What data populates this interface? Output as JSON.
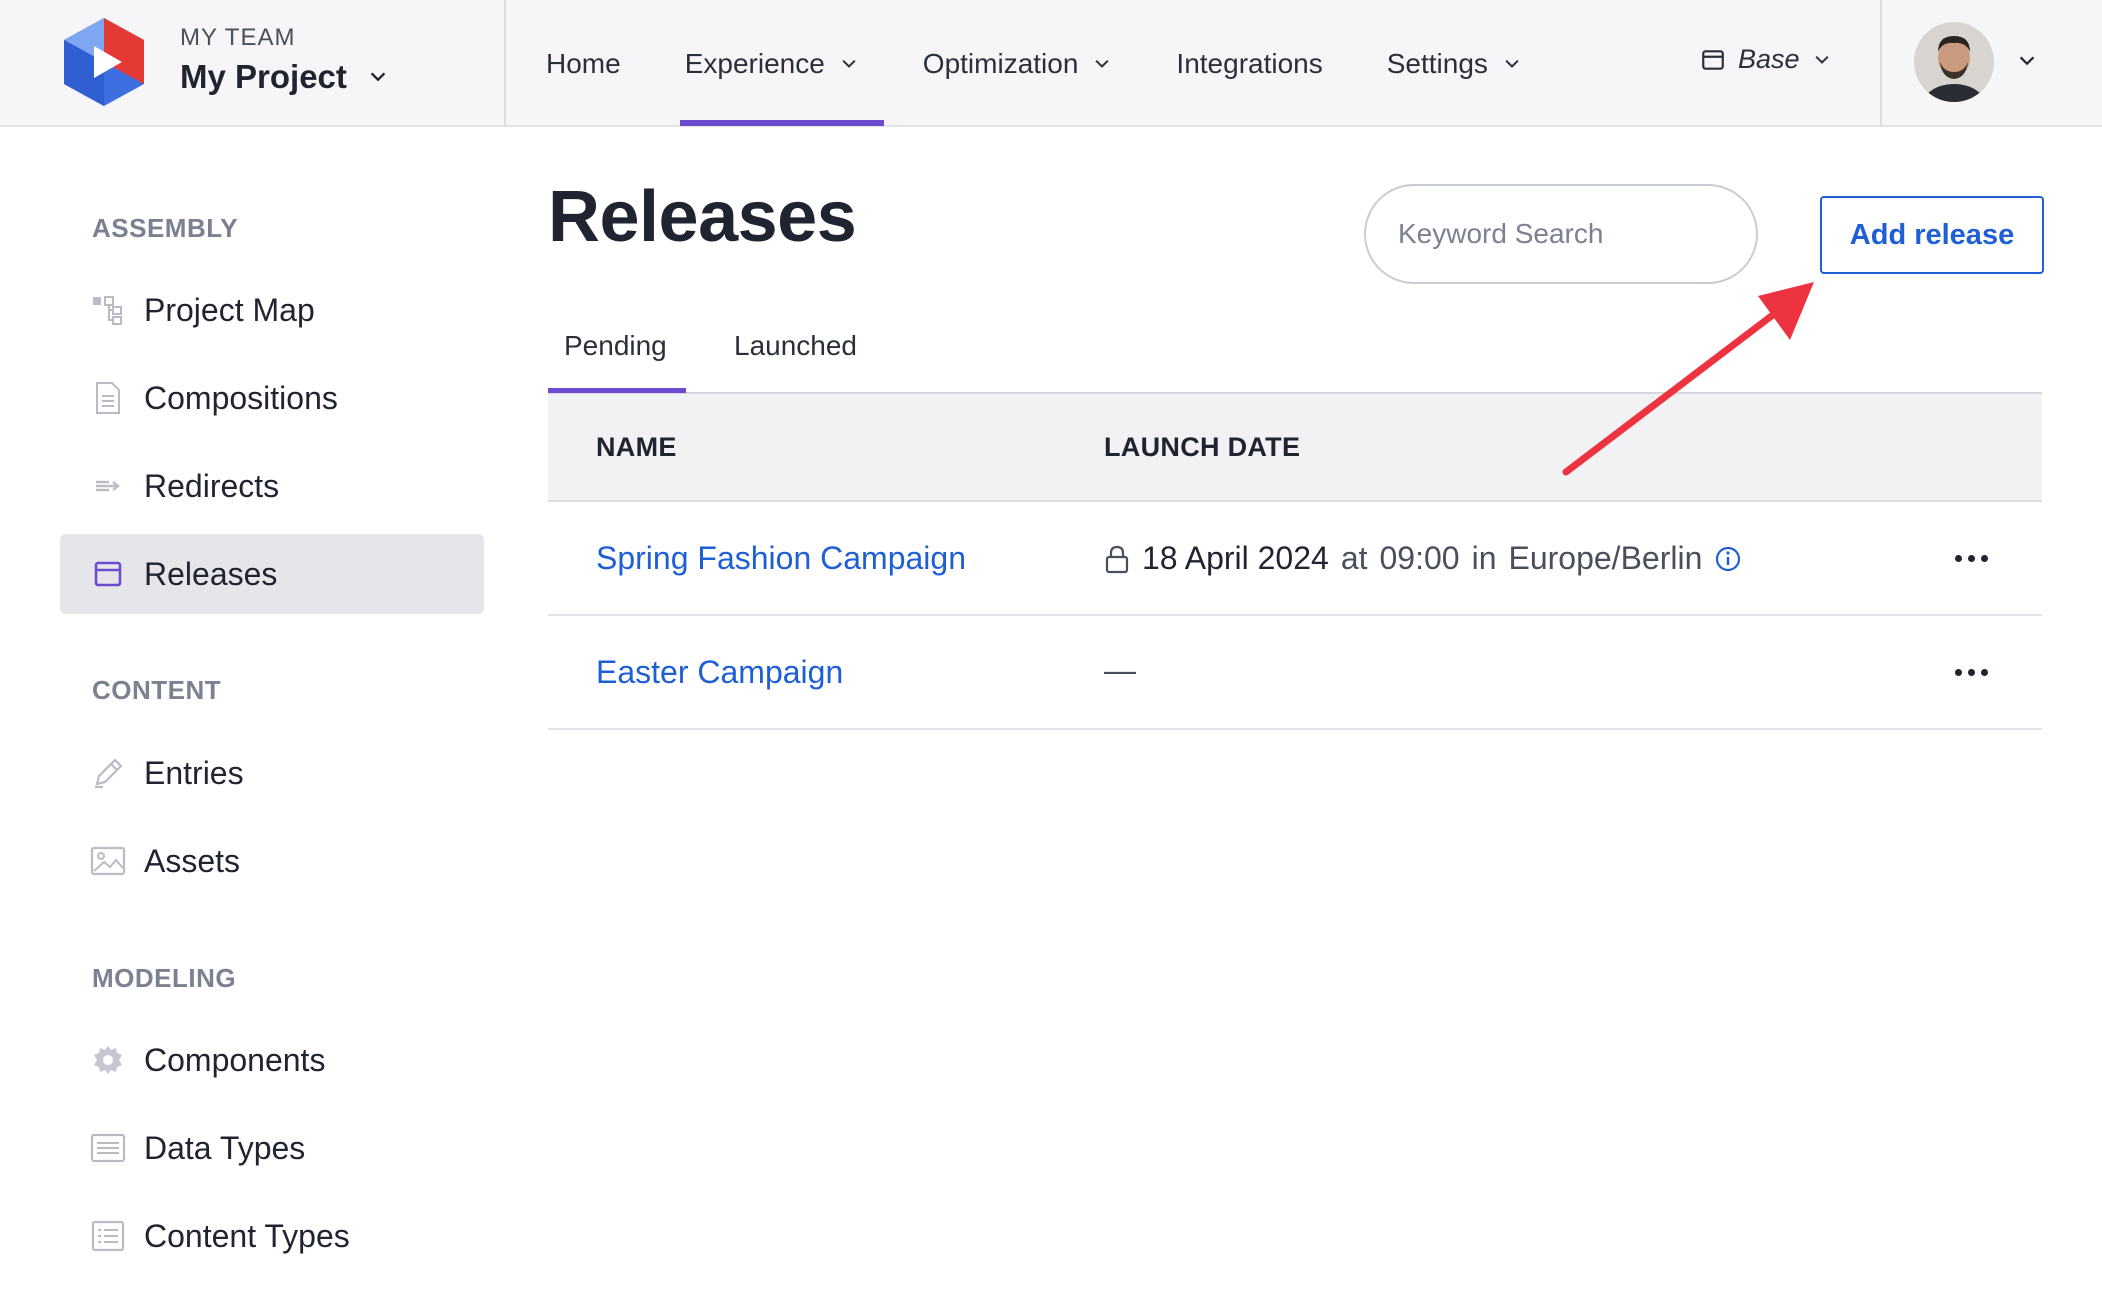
{
  "header": {
    "team_label": "MY TEAM",
    "project_name": "My Project",
    "nav": [
      {
        "label": "Home",
        "dropdown": false
      },
      {
        "label": "Experience",
        "dropdown": true,
        "active": true
      },
      {
        "label": "Optimization",
        "dropdown": true
      },
      {
        "label": "Integrations",
        "dropdown": false
      },
      {
        "label": "Settings",
        "dropdown": true
      }
    ],
    "environment": "Base"
  },
  "sidebar": {
    "sections": [
      {
        "title": "ASSEMBLY",
        "items": [
          {
            "label": "Project Map",
            "icon": "sitemap-icon"
          },
          {
            "label": "Compositions",
            "icon": "document-icon"
          },
          {
            "label": "Redirects",
            "icon": "redirect-icon"
          },
          {
            "label": "Releases",
            "icon": "calendar-icon",
            "active": true
          }
        ]
      },
      {
        "title": "CONTENT",
        "items": [
          {
            "label": "Entries",
            "icon": "pencil-icon"
          },
          {
            "label": "Assets",
            "icon": "image-icon"
          }
        ]
      },
      {
        "title": "MODELING",
        "items": [
          {
            "label": "Components",
            "icon": "gear-icon"
          },
          {
            "label": "Data Types",
            "icon": "list-icon"
          },
          {
            "label": "Content Types",
            "icon": "checklist-icon"
          }
        ]
      }
    ]
  },
  "main": {
    "title": "Releases",
    "search": {
      "placeholder": "Keyword Search",
      "value": ""
    },
    "add_button_label": "Add release",
    "tabs": [
      {
        "label": "Pending",
        "active": true
      },
      {
        "label": "Launched"
      }
    ],
    "table": {
      "columns": [
        "NAME",
        "LAUNCH DATE"
      ],
      "rows": [
        {
          "name": "Spring Fashion Campaign",
          "date": "18 April 2024",
          "at": "at",
          "time": "09:00",
          "in": "in",
          "zone": "Europe/Berlin",
          "locked": true
        },
        {
          "name": "Easter Campaign",
          "date_placeholder": "—"
        }
      ]
    }
  },
  "colors": {
    "accent": "#6c4bd1",
    "link": "#1f5fd6",
    "annotation_arrow": "#ee3340"
  }
}
